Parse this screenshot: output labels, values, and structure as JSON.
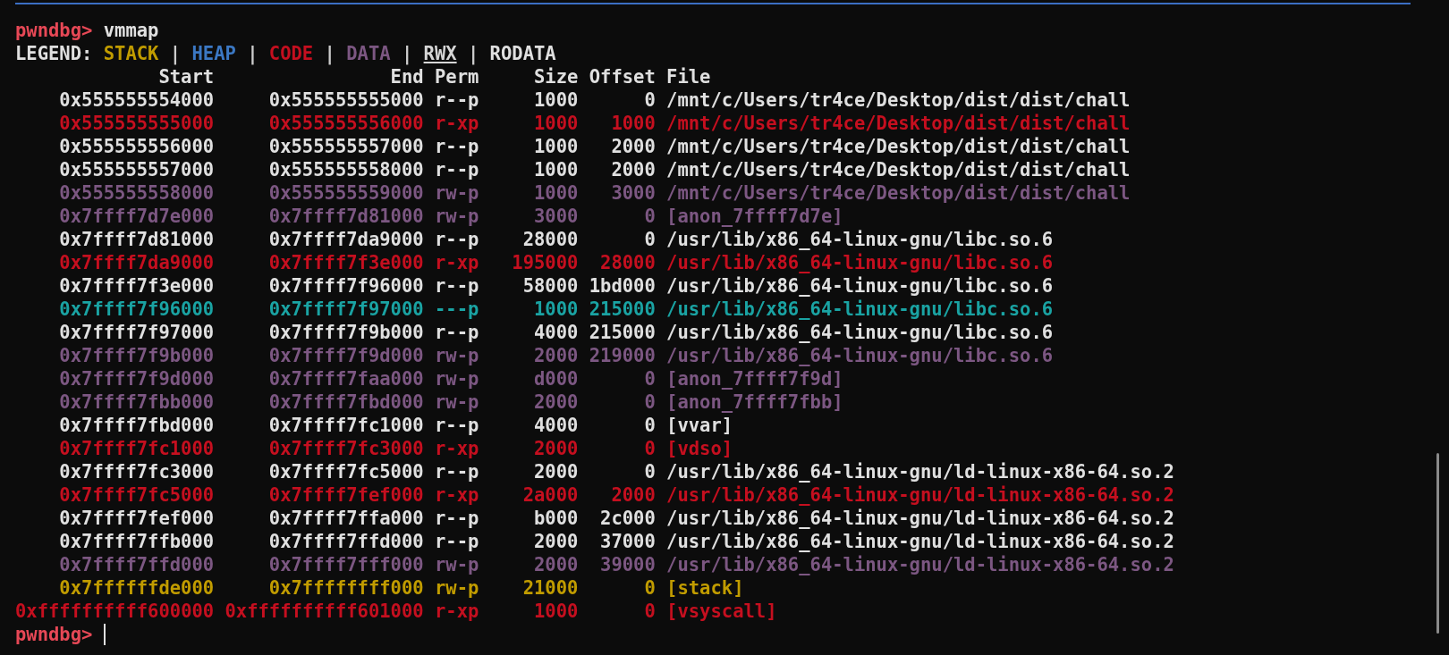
{
  "command": {
    "prompt": "pwndbg>",
    "text": "vmmap"
  },
  "legend": {
    "label": "LEGEND:",
    "items": [
      {
        "kind": "stack",
        "label": "STACK"
      },
      {
        "kind": "separator",
        "label": "|"
      },
      {
        "kind": "heap",
        "label": "HEAP"
      },
      {
        "kind": "separator",
        "label": "|"
      },
      {
        "kind": "code",
        "label": "CODE"
      },
      {
        "kind": "separator",
        "label": "|"
      },
      {
        "kind": "data",
        "label": "DATA"
      },
      {
        "kind": "separator",
        "label": "|"
      },
      {
        "kind": "rwx",
        "label": "RWX"
      },
      {
        "kind": "separator",
        "label": "|"
      },
      {
        "kind": "rodata",
        "label": "RODATA"
      }
    ]
  },
  "table": {
    "columns": [
      "Start",
      "End",
      "Perm",
      "Size",
      "Offset",
      "File"
    ],
    "rows": [
      {
        "kind": "rodata",
        "cells": [
          "0x555555554000",
          "0x555555555000",
          "r--p",
          "1000",
          "0",
          "/mnt/c/Users/tr4ce/Desktop/dist/dist/chall"
        ]
      },
      {
        "kind": "code",
        "cells": [
          "0x555555555000",
          "0x555555556000",
          "r-xp",
          "1000",
          "1000",
          "/mnt/c/Users/tr4ce/Desktop/dist/dist/chall"
        ]
      },
      {
        "kind": "rodata",
        "cells": [
          "0x555555556000",
          "0x555555557000",
          "r--p",
          "1000",
          "2000",
          "/mnt/c/Users/tr4ce/Desktop/dist/dist/chall"
        ]
      },
      {
        "kind": "rodata",
        "cells": [
          "0x555555557000",
          "0x555555558000",
          "r--p",
          "1000",
          "2000",
          "/mnt/c/Users/tr4ce/Desktop/dist/dist/chall"
        ]
      },
      {
        "kind": "data",
        "cells": [
          "0x555555558000",
          "0x555555559000",
          "rw-p",
          "1000",
          "3000",
          "/mnt/c/Users/tr4ce/Desktop/dist/dist/chall"
        ]
      },
      {
        "kind": "data",
        "cells": [
          "0x7ffff7d7e000",
          "0x7ffff7d81000",
          "rw-p",
          "3000",
          "0",
          "[anon_7ffff7d7e]"
        ]
      },
      {
        "kind": "rodata",
        "cells": [
          "0x7ffff7d81000",
          "0x7ffff7da9000",
          "r--p",
          "28000",
          "0",
          "/usr/lib/x86_64-linux-gnu/libc.so.6"
        ]
      },
      {
        "kind": "code",
        "cells": [
          "0x7ffff7da9000",
          "0x7ffff7f3e000",
          "r-xp",
          "195000",
          "28000",
          "/usr/lib/x86_64-linux-gnu/libc.so.6"
        ]
      },
      {
        "kind": "rodata",
        "cells": [
          "0x7ffff7f3e000",
          "0x7ffff7f96000",
          "r--p",
          "58000",
          "1bd000",
          "/usr/lib/x86_64-linux-gnu/libc.so.6"
        ]
      },
      {
        "kind": "none",
        "cells": [
          "0x7ffff7f96000",
          "0x7ffff7f97000",
          "---p",
          "1000",
          "215000",
          "/usr/lib/x86_64-linux-gnu/libc.so.6"
        ]
      },
      {
        "kind": "rodata",
        "cells": [
          "0x7ffff7f97000",
          "0x7ffff7f9b000",
          "r--p",
          "4000",
          "215000",
          "/usr/lib/x86_64-linux-gnu/libc.so.6"
        ]
      },
      {
        "kind": "data",
        "cells": [
          "0x7ffff7f9b000",
          "0x7ffff7f9d000",
          "rw-p",
          "2000",
          "219000",
          "/usr/lib/x86_64-linux-gnu/libc.so.6"
        ]
      },
      {
        "kind": "data",
        "cells": [
          "0x7ffff7f9d000",
          "0x7ffff7faa000",
          "rw-p",
          "d000",
          "0",
          "[anon_7ffff7f9d]"
        ]
      },
      {
        "kind": "data",
        "cells": [
          "0x7ffff7fbb000",
          "0x7ffff7fbd000",
          "rw-p",
          "2000",
          "0",
          "[anon_7ffff7fbb]"
        ]
      },
      {
        "kind": "rodata",
        "cells": [
          "0x7ffff7fbd000",
          "0x7ffff7fc1000",
          "r--p",
          "4000",
          "0",
          "[vvar]"
        ]
      },
      {
        "kind": "code",
        "cells": [
          "0x7ffff7fc1000",
          "0x7ffff7fc3000",
          "r-xp",
          "2000",
          "0",
          "[vdso]"
        ]
      },
      {
        "kind": "rodata",
        "cells": [
          "0x7ffff7fc3000",
          "0x7ffff7fc5000",
          "r--p",
          "2000",
          "0",
          "/usr/lib/x86_64-linux-gnu/ld-linux-x86-64.so.2"
        ]
      },
      {
        "kind": "code",
        "cells": [
          "0x7ffff7fc5000",
          "0x7ffff7fef000",
          "r-xp",
          "2a000",
          "2000",
          "/usr/lib/x86_64-linux-gnu/ld-linux-x86-64.so.2"
        ]
      },
      {
        "kind": "rodata",
        "cells": [
          "0x7ffff7fef000",
          "0x7ffff7ffa000",
          "r--p",
          "b000",
          "2c000",
          "/usr/lib/x86_64-linux-gnu/ld-linux-x86-64.so.2"
        ]
      },
      {
        "kind": "rodata",
        "cells": [
          "0x7ffff7ffb000",
          "0x7ffff7ffd000",
          "r--p",
          "2000",
          "37000",
          "/usr/lib/x86_64-linux-gnu/ld-linux-x86-64.so.2"
        ]
      },
      {
        "kind": "data",
        "cells": [
          "0x7ffff7ffd000",
          "0x7ffff7fff000",
          "rw-p",
          "2000",
          "39000",
          "/usr/lib/x86_64-linux-gnu/ld-linux-x86-64.so.2"
        ]
      },
      {
        "kind": "stack",
        "cells": [
          "0x7ffffffde000",
          "0x7ffffffff000",
          "rw-p",
          "21000",
          "0",
          "[stack]"
        ]
      },
      {
        "kind": "code",
        "cells": [
          "0xffffffffff600000",
          "0xffffffffff601000",
          "r-xp",
          "1000",
          "0",
          "[vsyscall]"
        ]
      }
    ]
  },
  "prompt": {
    "text": "pwndbg>"
  }
}
